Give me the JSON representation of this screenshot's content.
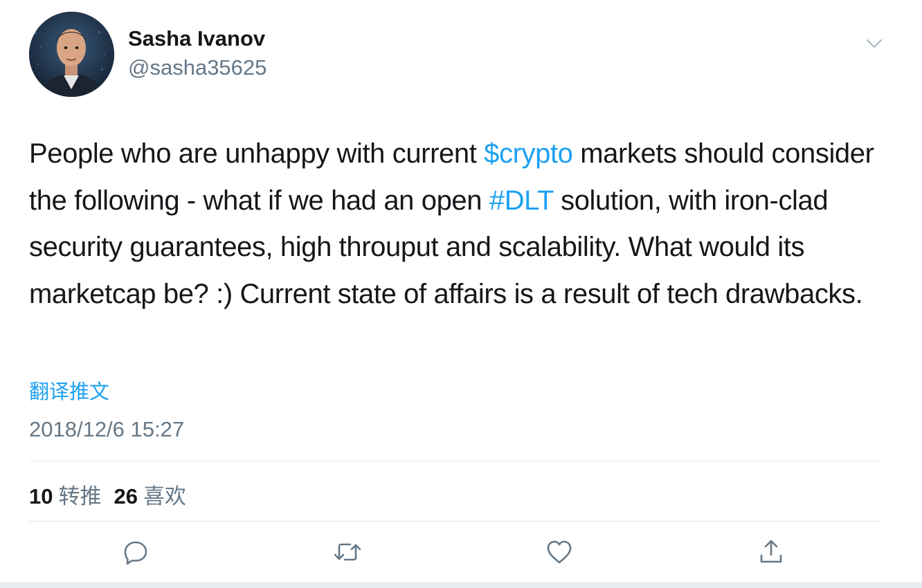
{
  "author": {
    "name": "Sasha Ivanov",
    "handle": "@sasha35625"
  },
  "tweet": {
    "segments": [
      {
        "text": "People who are unhappy with current ",
        "type": "text"
      },
      {
        "text": "$crypto",
        "type": "cashtag"
      },
      {
        "text": " markets should consider the following - what if we had an open ",
        "type": "text"
      },
      {
        "text": "#DLT",
        "type": "hashtag"
      },
      {
        "text": " solution, with iron-clad security guarantees, high throuput and scalability. What would its marketcap be? :) Current state of affairs is a result of tech drawbacks.",
        "type": "text"
      }
    ],
    "translate_label": "翻译推文",
    "timestamp": "2018/12/6 15:27"
  },
  "stats": {
    "retweets_count": "10",
    "retweets_label": "转推",
    "likes_count": "26",
    "likes_label": "喜欢"
  },
  "actions": [
    "reply-icon",
    "retweet-icon",
    "like-icon",
    "share-icon"
  ],
  "colors": {
    "link": "#1da1f2",
    "text": "#14171a",
    "secondary": "#657786",
    "divider": "#e1e8ed"
  }
}
